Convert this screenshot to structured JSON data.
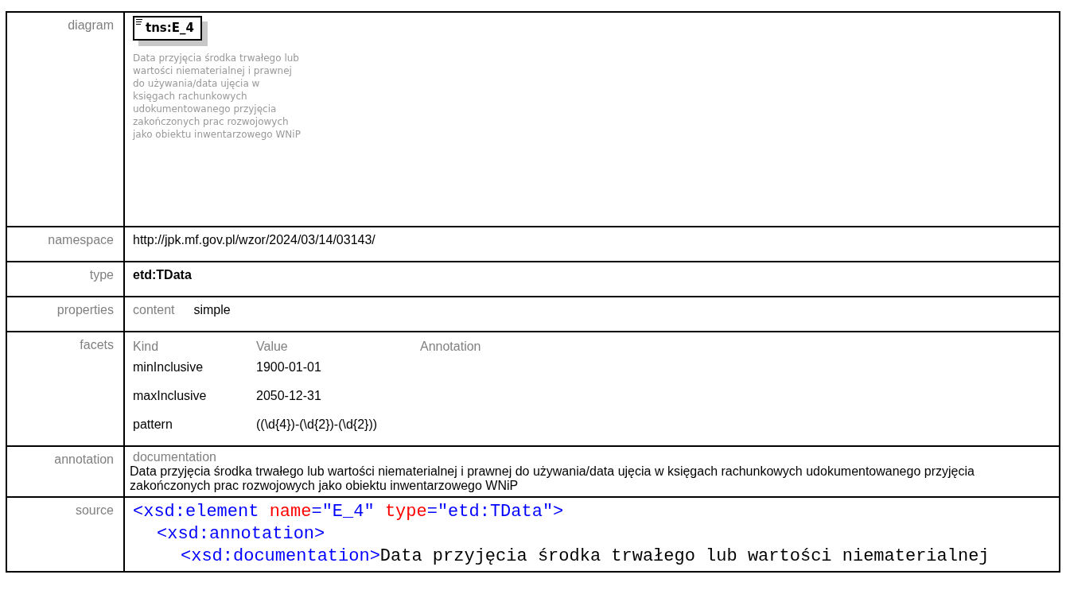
{
  "diagram": {
    "label": "diagram",
    "element_name": "tns:E_4",
    "description": "Data przyjęcia środka trwałego lub wartości niematerialnej i prawnej do używania/data ujęcia w księgach rachunkowych udokumentowanego przyjęcia zakończonych prac rozwojowych jako obiektu inwentarzowego WNiP"
  },
  "namespace": {
    "label": "namespace",
    "value": "http://jpk.mf.gov.pl/wzor/2024/03/14/03143/"
  },
  "type": {
    "label": "type",
    "value": "etd:TData"
  },
  "properties": {
    "label": "properties",
    "name": "content",
    "value": "simple"
  },
  "facets": {
    "label": "facets",
    "columns": [
      "Kind",
      "Value",
      "Annotation"
    ],
    "rows": [
      {
        "kind": "minInclusive",
        "value": "1900-01-01"
      },
      {
        "kind": "maxInclusive",
        "value": "2050-12-31"
      },
      {
        "kind": "pattern",
        "value": "((\\d{4})-(\\d{2})-(\\d{2}))"
      }
    ]
  },
  "annotation": {
    "label": "annotation",
    "heading": "documentation",
    "text": "Data przyjęcia środka trwałego lub wartości niematerialnej i prawnej do używania/data ujęcia w księgach rachunkowych udokumentowanego przyjęcia zakończonych prac rozwojowych jako obiektu inwentarzowego WNiP"
  },
  "source": {
    "label": "source",
    "lines": [
      {
        "tokens": [
          {
            "kind": "tag",
            "text": "<xsd:element "
          },
          {
            "kind": "attr",
            "text": "name"
          },
          {
            "kind": "tag",
            "text": "=\"E_4\" "
          },
          {
            "kind": "attr",
            "text": "type"
          },
          {
            "kind": "tag",
            "text": "=\"etd:TData\">"
          }
        ],
        "children": [
          {
            "tokens": [
              {
                "kind": "tag",
                "text": "<xsd:annotation>"
              }
            ],
            "children": [
              {
                "tokens": [
                  {
                    "kind": "tag",
                    "text": "<xsd:documentation>"
                  },
                  {
                    "kind": "text",
                    "text": "Data przyjęcia środka trwałego lub wartości niematerialnej"
                  }
                ]
              }
            ]
          }
        ]
      }
    ]
  }
}
